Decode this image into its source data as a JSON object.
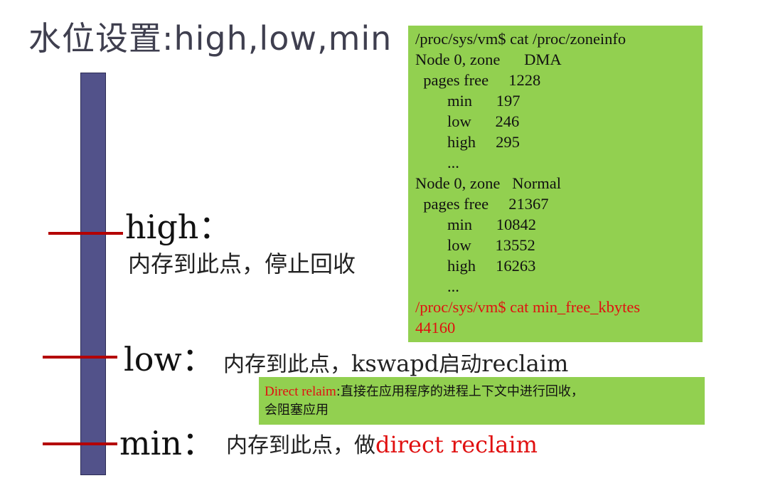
{
  "title": "水位设置:high,low,min",
  "levels": {
    "high": {
      "label": "high：",
      "desc": "内存到此点，停止回收"
    },
    "low": {
      "label": "low：",
      "desc_cn1": "内存到此点，",
      "desc_en1": "kswapd",
      "desc_cn2": "启动",
      "desc_en2": "reclaim"
    },
    "min": {
      "label": "min：",
      "desc_cn": "内存到此点，做",
      "desc_red": "direct reclaim"
    }
  },
  "zoneinfo": {
    "lines": [
      "/proc/sys/vm$ cat /proc/zoneinfo",
      "Node 0, zone      DMA",
      "  pages free     1228",
      "        min      197",
      "        low      246",
      "        high     295",
      "        ...",
      "Node 0, zone   Normal",
      "  pages free     21367",
      "        min      10842",
      "        low      13552",
      "        high     16263",
      "        ...",
      "/proc/sys/vm$ cat min_free_kbytes",
      "44160"
    ]
  },
  "direct_note": {
    "term": "Direct relaim",
    "text": ":直接在应用程序的进程上下文中进行回收，",
    "text2": "会阻塞应用"
  },
  "colors": {
    "bar": "#52528a",
    "tick": "#b40000",
    "box": "#92d050",
    "highlight": "#e01010"
  }
}
